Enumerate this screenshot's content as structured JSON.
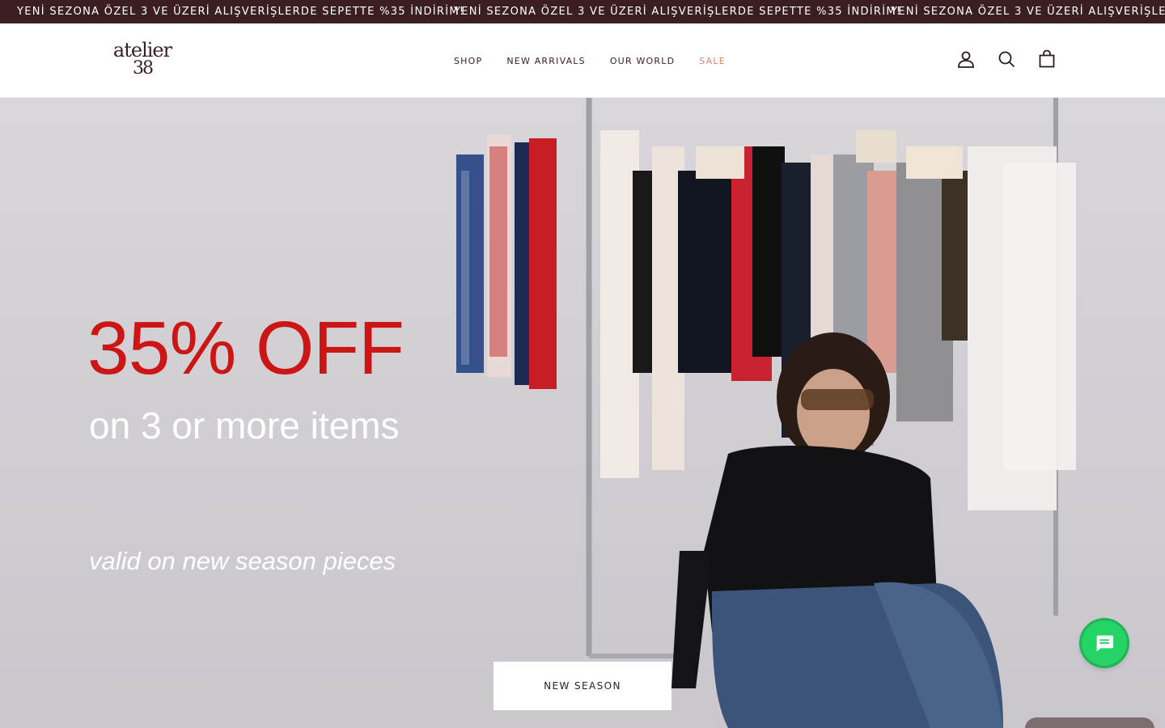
{
  "announcement": {
    "text": "YENİ SEZONA ÖZEL 3 VE ÜZERİ ALIŞVERİŞLERDE SEPETTE %35 İNDİRİM!",
    "repeat_count": 3,
    "background": "#3a1e22"
  },
  "header": {
    "logo": {
      "line1": "atelier",
      "line2": "38"
    },
    "nav": [
      {
        "label": "SHOP"
      },
      {
        "label": "NEW ARRIVALS"
      },
      {
        "label": "OUR WORLD"
      },
      {
        "label": "SALE",
        "color": "#d9866c"
      }
    ],
    "icons": [
      "account-icon",
      "search-icon",
      "cart-icon"
    ]
  },
  "hero": {
    "headline": "35% OFF",
    "headline_color": "#cc1616",
    "subline": "on 3 or more items",
    "valid_line": "valid on new season pieces",
    "cta_label": "NEW SEASON"
  },
  "widgets": {
    "chat_icon": "chat-icon",
    "chat_color": "#25d366"
  }
}
